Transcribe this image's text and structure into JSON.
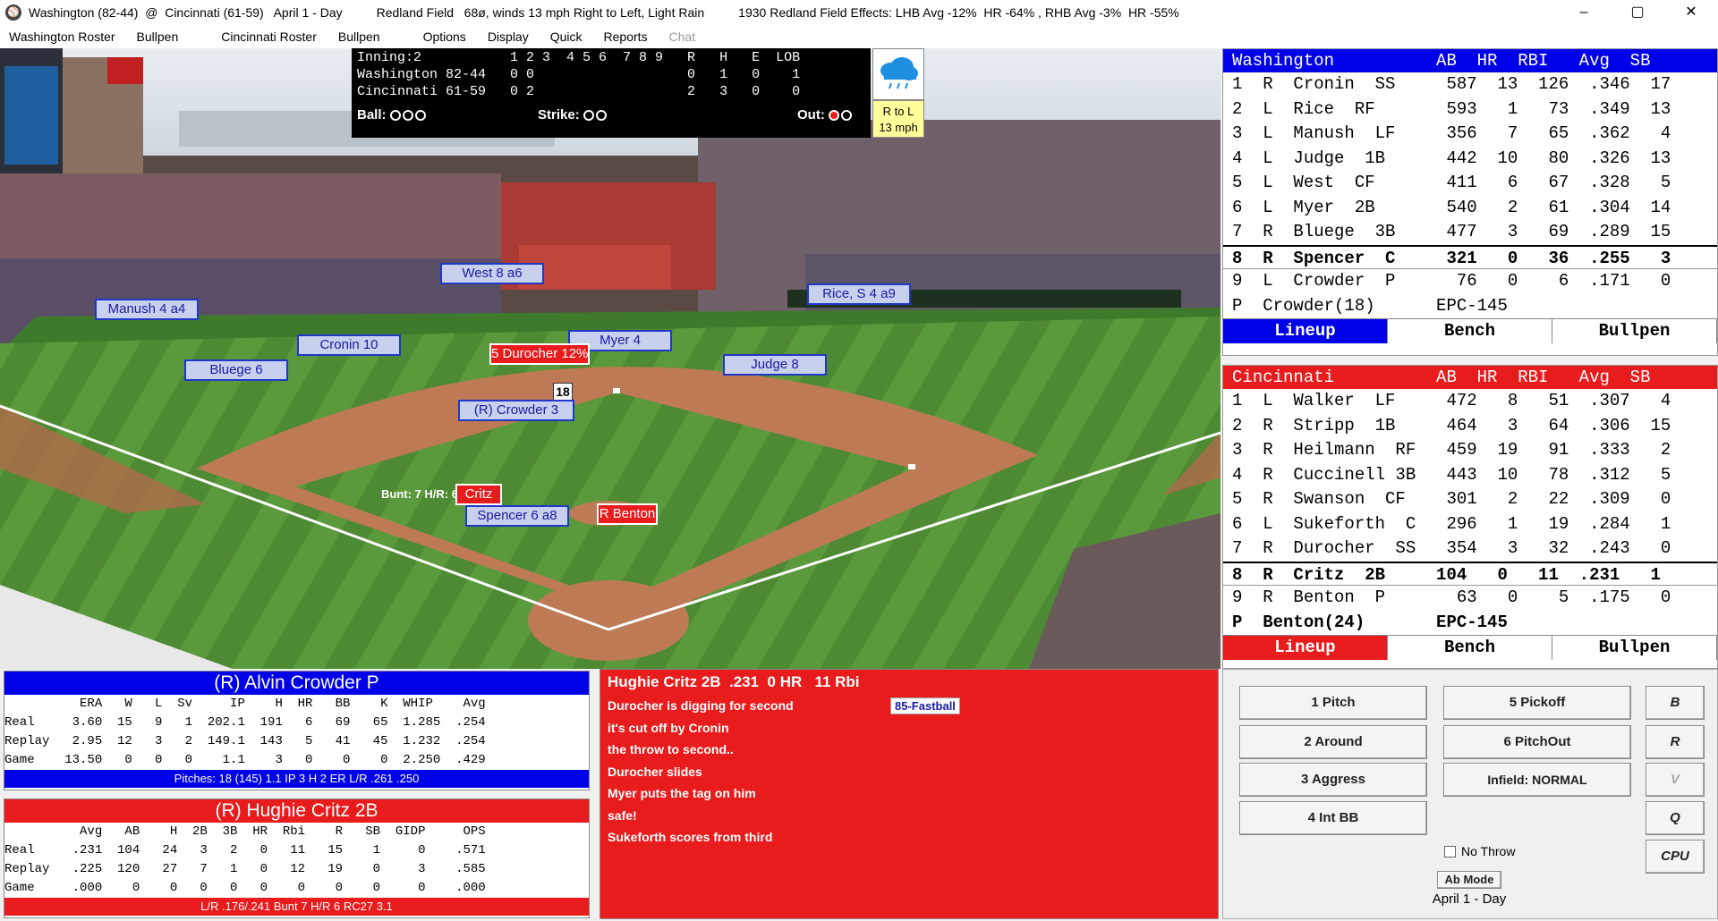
{
  "titlebar": {
    "seg1": "Washington (82-44)  @  Cincinnati (61-59)   April 1 - Day",
    "seg2": "Redland Field   68ø, winds 13 mph Right to Left, Light Rain",
    "seg3": "1930 Redland Field Effects: LHB Avg -12%  HR -64% , RHB Avg -3%  HR -55%"
  },
  "window_controls": {
    "minimize": "–",
    "maximize": "▢",
    "close": "✕"
  },
  "menu": [
    "Washington Roster",
    "Bullpen",
    "Cincinnati Roster",
    "Bullpen",
    "Options",
    "Display",
    "Quick",
    "Reports",
    "Chat"
  ],
  "scoreboard": {
    "line1": "Inning:2           1 2 3  4 5 6  7 8 9   R   H   E  LOB",
    "line2": "Washington 82-44   0 0                   0   1   0    1",
    "line3": "Cincinnati 61-59   0 2                   2   3   0    0",
    "ball_label": "Ball:",
    "strike_label": "Strike:",
    "out_label": "Out:"
  },
  "count": {
    "balls": 0,
    "strikes": 0,
    "outs": 1
  },
  "wind": {
    "dir": "R to L",
    "speed": "13 mph"
  },
  "field_labels": {
    "west": "West  8 a6",
    "manush": "Manush  4 a4",
    "rice": "Rice, S  4 a9",
    "cronin": "Cronin  10",
    "myer": "Myer  4",
    "durocher": "5 Durocher 12%",
    "bluege": "Bluege  6",
    "judge": "Judge  8",
    "pitch_count": "18",
    "crowder": "(R) Crowder 3",
    "bunt": "Bunt: 7  H/R: 6",
    "critz": "Critz",
    "spencer": "Spencer  6 a8",
    "benton": "R Benton"
  },
  "washington": {
    "header": "Washington          AB  HR  RBI   Avg  SB",
    "rows": [
      "1  R  Cronin  SS     587  13  126  .346  17",
      "2  L  Rice  RF       593   1   73  .349  13",
      "3  L  Manush  LF     356   7   65  .362   4",
      "4  L  Judge  1B      442  10   80  .326  13",
      "5  L  West  CF       411   6   67  .328   5",
      "6  L  Myer  2B       540   2   61  .304  14",
      "7  R  Bluege  3B     477   3   69  .289  15",
      "8  R  Spencer  C     321   0   36  .255   3",
      "9  L  Crowder  P      76   0    6  .171   0",
      "P  Crowder(18)      EPC-145"
    ],
    "tabs": [
      "Lineup",
      "Bench",
      "Bullpen"
    ]
  },
  "cincinnati": {
    "header": "Cincinnati          AB  HR  RBI   Avg  SB",
    "rows": [
      "1  L  Walker  LF     472   8   51  .307   4",
      "2  R  Stripp  1B     464   3   64  .306  15",
      "3  R  Heilmann  RF   459  19   91  .333   2",
      "4  R  Cuccinell 3B   443  10   78  .312   5",
      "5  R  Swanson  CF    301   2   22  .309   0",
      "6  L  Sukeforth  C   296   1   19  .284   1",
      "7  R  Durocher  SS   354   3   32  .243   0",
      "8  R  Critz  2B     104   0   11  .231   1",
      "9  R  Benton  P       63   0    5  .175   0",
      "P  Benton(24)       EPC-145"
    ],
    "tabs": [
      "Lineup",
      "Bench",
      "Bullpen"
    ]
  },
  "pitcher": {
    "title": "(R) Alvin Crowder P",
    "header": "          ERA   W   L  Sv     IP    H  HR   BB    K  WHIP    Avg",
    "rows": [
      "Real     3.60  15   9   1  202.1  191   6   69   65  1.285  .254",
      "Replay   2.95  12   3   2  149.1  143   5   41   45  1.232  .254",
      "Game    13.50   0   0   0    1.1    3   0    0    0  2.250  .429"
    ],
    "footer": "Pitches: 18 (145)     1.1 IP   3 H  2 ER      L/R .261 .250"
  },
  "batter": {
    "title": "(R) Hughie Critz 2B",
    "header": "          Avg   AB    H  2B  3B  HR  Rbi    R   SB  GIDP     OPS",
    "rows": [
      "Real     .231  104   24   3   2   0   11   15    1     0    .571",
      "Replay   .225  120   27   7   1   0   12   19    0     3    .585",
      "Game     .000    0    0   0   0   0    0    0    0     0    .000"
    ],
    "footer": "L/R .176/.241     Bunt 7     H/R 6      RC27  3.1"
  },
  "pbp": {
    "title": "Hughie Critz 2B  .231  0 HR   11 Rbi",
    "pitch": "85-Fastball",
    "events": [
      "Durocher is digging for second",
      "it's cut off by Cronin",
      "the throw to second..",
      "Durocher slides",
      "Myer puts the tag on him",
      "safe!",
      "Sukeforth scores from third"
    ]
  },
  "controls": {
    "pitch": "1 Pitch",
    "around": "2 Around",
    "aggress": "3 Aggress",
    "intbb": "4 Int BB",
    "pickoff": "5 Pickoff",
    "pitchout": "6 PitchOut",
    "infield": "Infield: NORMAL",
    "b": "B",
    "r": "R",
    "v": "V",
    "q": "Q",
    "cpu": "CPU",
    "nothrow": "No Throw",
    "abmode": "Ab Mode",
    "date": "April 1 - Day"
  },
  "colors": {
    "washington": "#0000e8",
    "cincinnati": "#e81c1c",
    "label_bg": "#c7d1ee",
    "label_border": "#2038c8"
  }
}
